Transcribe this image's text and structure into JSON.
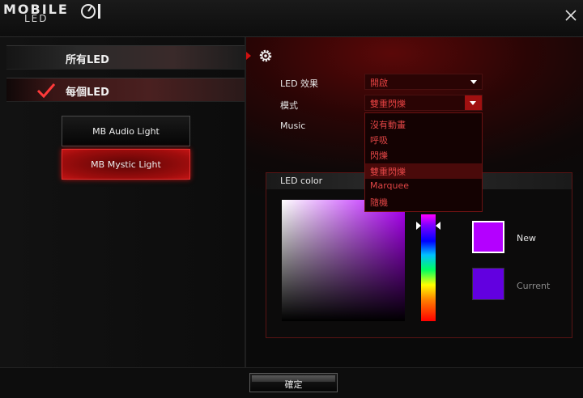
{
  "app": {
    "logo_main": "MOBILE",
    "logo_sub": "LED"
  },
  "left": {
    "tabs": [
      {
        "label": "所有LED",
        "selected": false
      },
      {
        "label": "每個LED",
        "selected": true
      }
    ],
    "buttons": [
      {
        "label": "MB Audio Light"
      },
      {
        "label": "MB Mystic Light"
      }
    ]
  },
  "settings": {
    "effect_label": "LED 效果",
    "effect_value": "開啟",
    "mode_label": "模式",
    "mode_value": "雙重閃爍",
    "music_label": "Music",
    "mode_options": [
      "沒有動畫",
      "呼吸",
      "閃爍",
      "雙重閃爍",
      "Marquee",
      "隨機"
    ],
    "mode_selected_index": 3
  },
  "color": {
    "title": "LED color",
    "new_label": "New",
    "current_label": "Current",
    "new_color": "#b400ff",
    "current_color": "#6200e0"
  },
  "footer": {
    "ok_label": "確定"
  },
  "colors": {
    "accent": "#d01010",
    "dropdown_text": "#e04040"
  }
}
